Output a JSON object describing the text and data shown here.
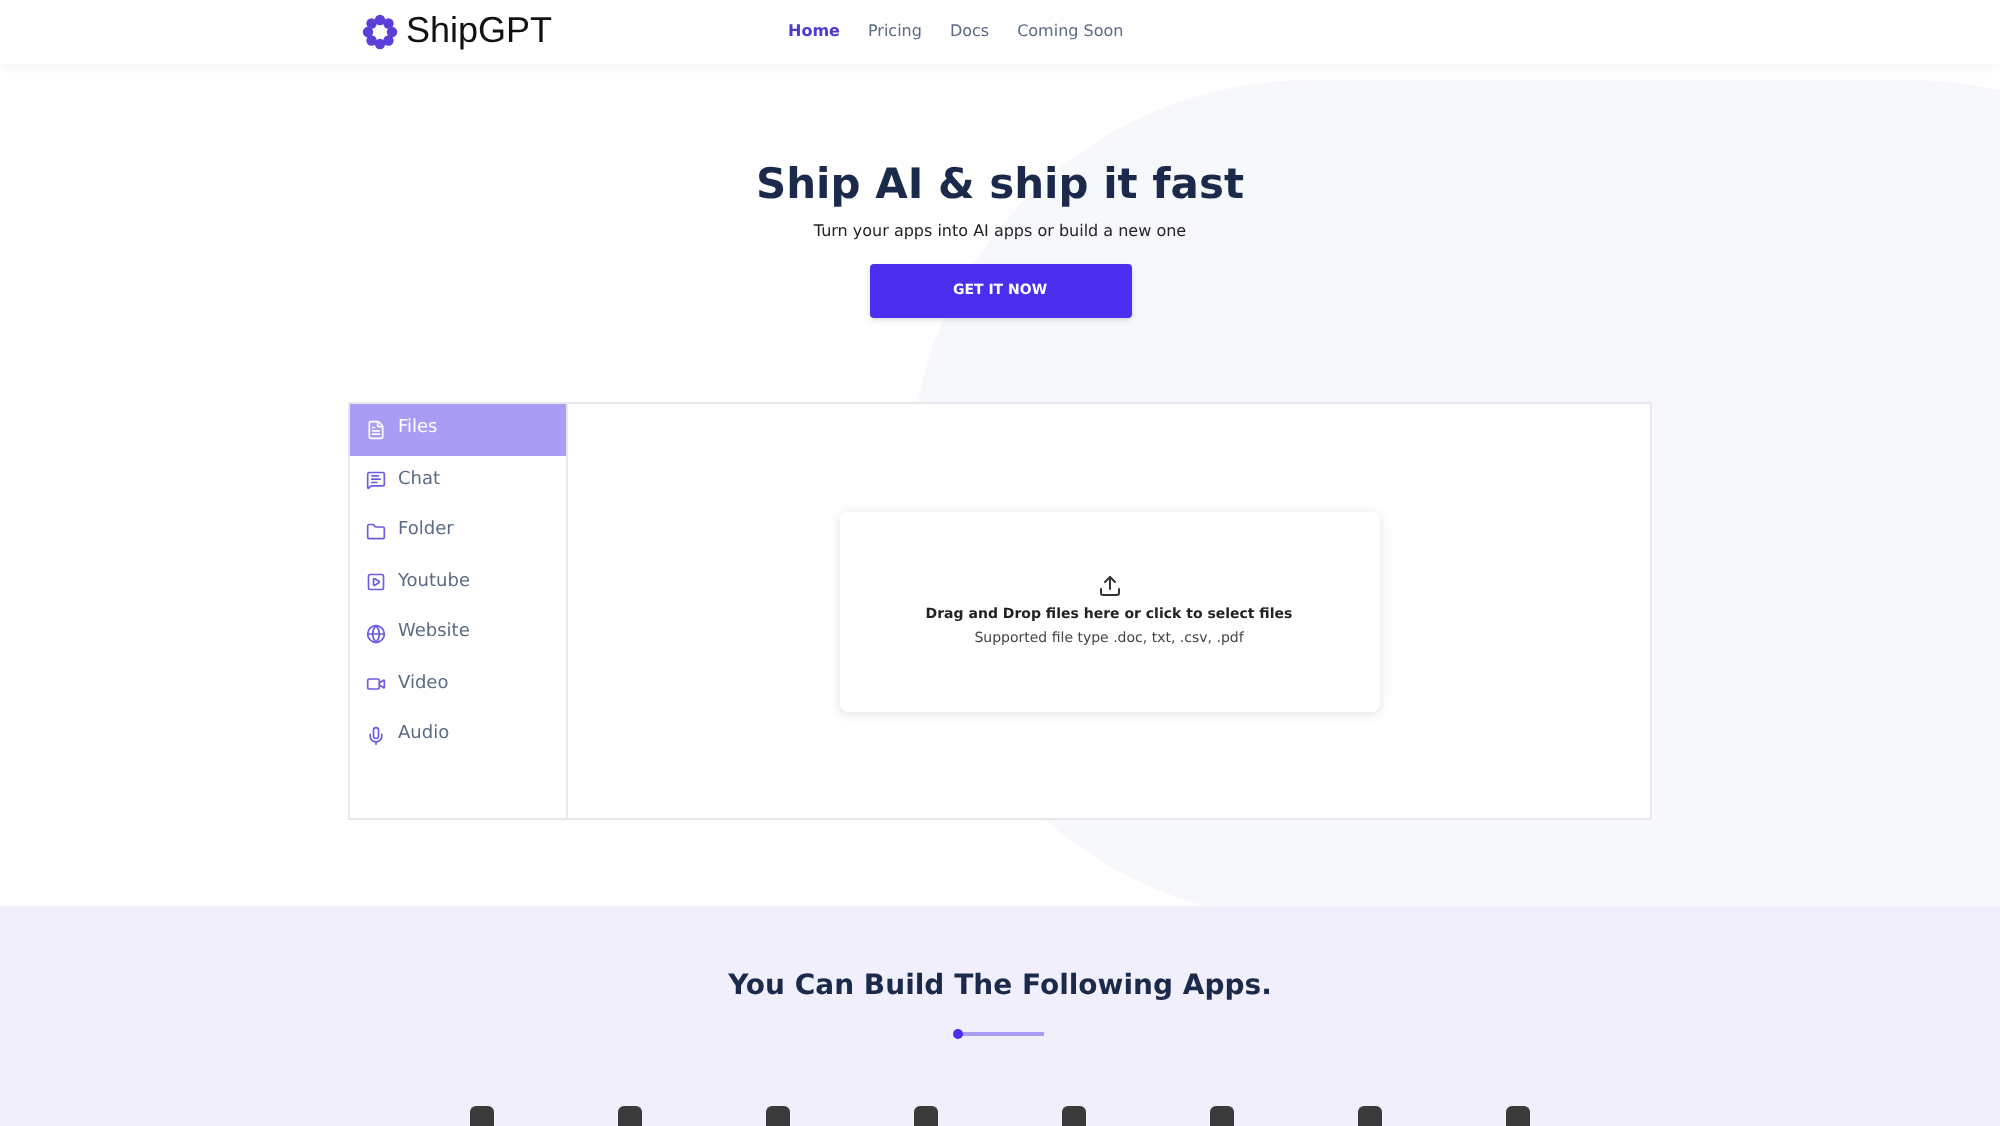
{
  "header": {
    "brand": "ShipGPT",
    "nav": [
      {
        "label": "Home",
        "selected": true
      },
      {
        "label": "Pricing",
        "selected": false
      },
      {
        "label": "Docs",
        "selected": false
      },
      {
        "label": "Coming Soon",
        "selected": false
      }
    ]
  },
  "hero": {
    "title": "Ship AI & ship it fast",
    "subtitle": "Turn your apps into AI apps or build a new one",
    "cta": "GET IT NOW"
  },
  "sources": [
    {
      "label": "Files",
      "kind": "file",
      "selected": true
    },
    {
      "label": "Chat",
      "kind": "chat",
      "selected": false
    },
    {
      "label": "Folder",
      "kind": "folder",
      "selected": false
    },
    {
      "label": "Youtube",
      "kind": "youtube",
      "selected": false
    },
    {
      "label": "Website",
      "kind": "website",
      "selected": false
    },
    {
      "label": "Video",
      "kind": "video",
      "selected": false
    },
    {
      "label": "Audio",
      "kind": "audio",
      "selected": false
    }
  ],
  "upload": {
    "title": "Drag and Drop files here or click to select files",
    "hint": "Supported file type .doc, txt, .csv, .pdf"
  },
  "apps": {
    "title": "You Can Build The Following Apps."
  }
}
